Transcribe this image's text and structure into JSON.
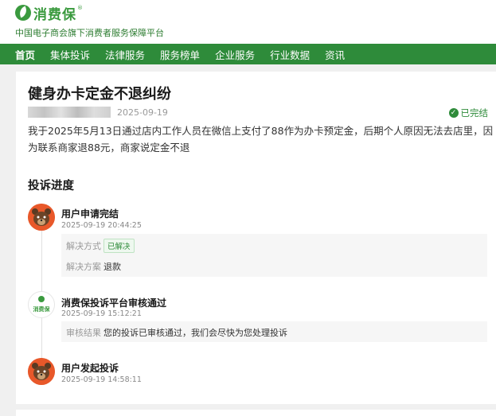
{
  "header": {
    "logo_text": "消费保",
    "logo_reg": "®",
    "tagline": "中国电子商会旗下消费者服务保障平台"
  },
  "nav": {
    "items": [
      {
        "label": "首页"
      },
      {
        "label": "集体投诉"
      },
      {
        "label": "法律服务"
      },
      {
        "label": "服务榜单"
      },
      {
        "label": "企业服务"
      },
      {
        "label": "行业数据"
      },
      {
        "label": "资讯"
      }
    ]
  },
  "complaint": {
    "title": "健身办卡定金不退纠纷",
    "date": "2025-09-19",
    "status": "已完结",
    "status_icon": "check-circle-icon",
    "description": "我于2025年5月13日通过店内工作人员在微信上支付了88作为办卡预定金，后期个人原因无法去店里，因为联系商家退88元，商家说定金不退"
  },
  "progress": {
    "section_title": "投诉进度",
    "steps": [
      {
        "avatar": "bear-avatar",
        "title": "用户申请完结",
        "time": "2025-09-19 20:44:25",
        "method_label": "解决方式",
        "method_value": "已解决",
        "plan_label": "解决方案",
        "plan_value": "退款"
      },
      {
        "avatar": "xfb-logo-avatar",
        "avatar_text": "消费保",
        "title": "消费保投诉平台审核通过",
        "time": "2025-09-19 15:12:21",
        "result_label": "审核结果",
        "result_value": "您的投诉已审核通过，我们会尽快为您处理投诉"
      },
      {
        "avatar": "bear-avatar",
        "title": "用户发起投诉",
        "time": "2025-09-19 14:58:11"
      }
    ]
  },
  "colors": {
    "brand_green": "#2e8b3a",
    "avatar_orange": "#e8582a"
  }
}
